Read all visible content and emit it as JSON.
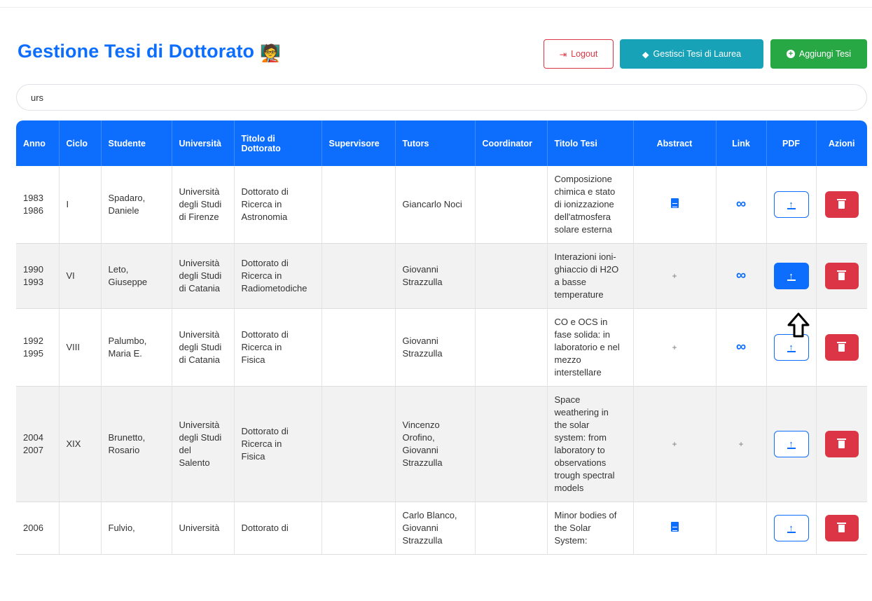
{
  "header": {
    "title": "Gestione Tesi di Dottorato",
    "title_emoji": "🧑‍🏫",
    "logout_label": "Logout",
    "laurea_label": "Gestisci Tesi di Laurea",
    "add_label": "Aggiungi Tesi"
  },
  "search": {
    "value": "urs"
  },
  "table": {
    "columns": [
      "Anno",
      "Ciclo",
      "Studente",
      "Università",
      "Titolo di Dottorato",
      "Supervisore",
      "Tutors",
      "Coordinator",
      "Titolo Tesi",
      "Abstract",
      "Link",
      "PDF",
      "Azioni"
    ],
    "rows": [
      {
        "anno": "1983\n1986",
        "ciclo": "I",
        "studente": "Spadaro,\nDaniele",
        "universita": "Università\ndegli Studi\ndi Firenze",
        "titolo_dottorato": "Dottorato di\nRicerca in\nAstronomia",
        "supervisore": "",
        "tutors": "Giancarlo Noci",
        "coordinator": "",
        "titolo_tesi": "Composizione\nchimica e stato\ndi ionizzazione\ndell'atmosfera\nsolare esterna",
        "abstract": "doc",
        "link": "link",
        "pdf_active": false
      },
      {
        "anno": "1990\n1993",
        "ciclo": "VI",
        "studente": "Leto,\nGiuseppe",
        "universita": "Università\ndegli Studi\ndi Catania",
        "titolo_dottorato": "Dottorato di\nRicerca in\nRadiometodiche",
        "supervisore": "",
        "tutors": "Giovanni\nStrazzulla",
        "coordinator": "",
        "titolo_tesi": "Interazioni ioni-\nghiaccio di H2O\na basse\ntemperature",
        "abstract": "+",
        "link": "link",
        "pdf_active": true
      },
      {
        "anno": "1992\n1995",
        "ciclo": "VIII",
        "studente": "Palumbo,\nMaria E.",
        "universita": "Università\ndegli Studi\ndi Catania",
        "titolo_dottorato": "Dottorato di\nRicerca in\nFisica",
        "supervisore": "",
        "tutors": "Giovanni\nStrazzulla",
        "coordinator": "",
        "titolo_tesi": "CO e OCS in\nfase solida: in\nlaboratorio e nel\nmezzo\ninterstellare",
        "abstract": "+",
        "link": "link",
        "pdf_active": false
      },
      {
        "anno": "2004\n2007",
        "ciclo": "XIX",
        "studente": "Brunetto,\nRosario",
        "universita": "Università\ndegli Studi\ndel\nSalento",
        "titolo_dottorato": "Dottorato di\nRicerca in\nFisica",
        "supervisore": "",
        "tutors": "Vincenzo\nOrofino,\nGiovanni\nStrazzulla",
        "coordinator": "",
        "titolo_tesi": "Space\nweathering in\nthe solar\nsystem: from\nlaboratory to\nobservations\ntrough spectral\nmodels",
        "abstract": "+",
        "link": "+",
        "pdf_active": false
      },
      {
        "anno": "2006",
        "ciclo": "",
        "studente": "Fulvio,",
        "universita": "Università",
        "titolo_dottorato": "Dottorato di",
        "supervisore": "",
        "tutors": "Carlo Blanco,\nGiovanni\nStrazzulla",
        "coordinator": "",
        "titolo_tesi": "Minor bodies of\nthe Solar\nSystem:",
        "abstract": "doc",
        "link": "",
        "pdf_active": false
      }
    ]
  },
  "icons": {
    "logout": "sign-out-icon",
    "laurea": "graduation-cap-icon",
    "add": "plus-circle-icon",
    "abstract": "file-text-icon",
    "link": "link-icon",
    "pdf": "upload-icon",
    "delete": "trash-icon",
    "cursor": "arrow-up-cursor-icon"
  },
  "colors": {
    "primary": "#0d6efd",
    "danger": "#dc3545",
    "info": "#17a2b8",
    "success": "#28a745"
  }
}
